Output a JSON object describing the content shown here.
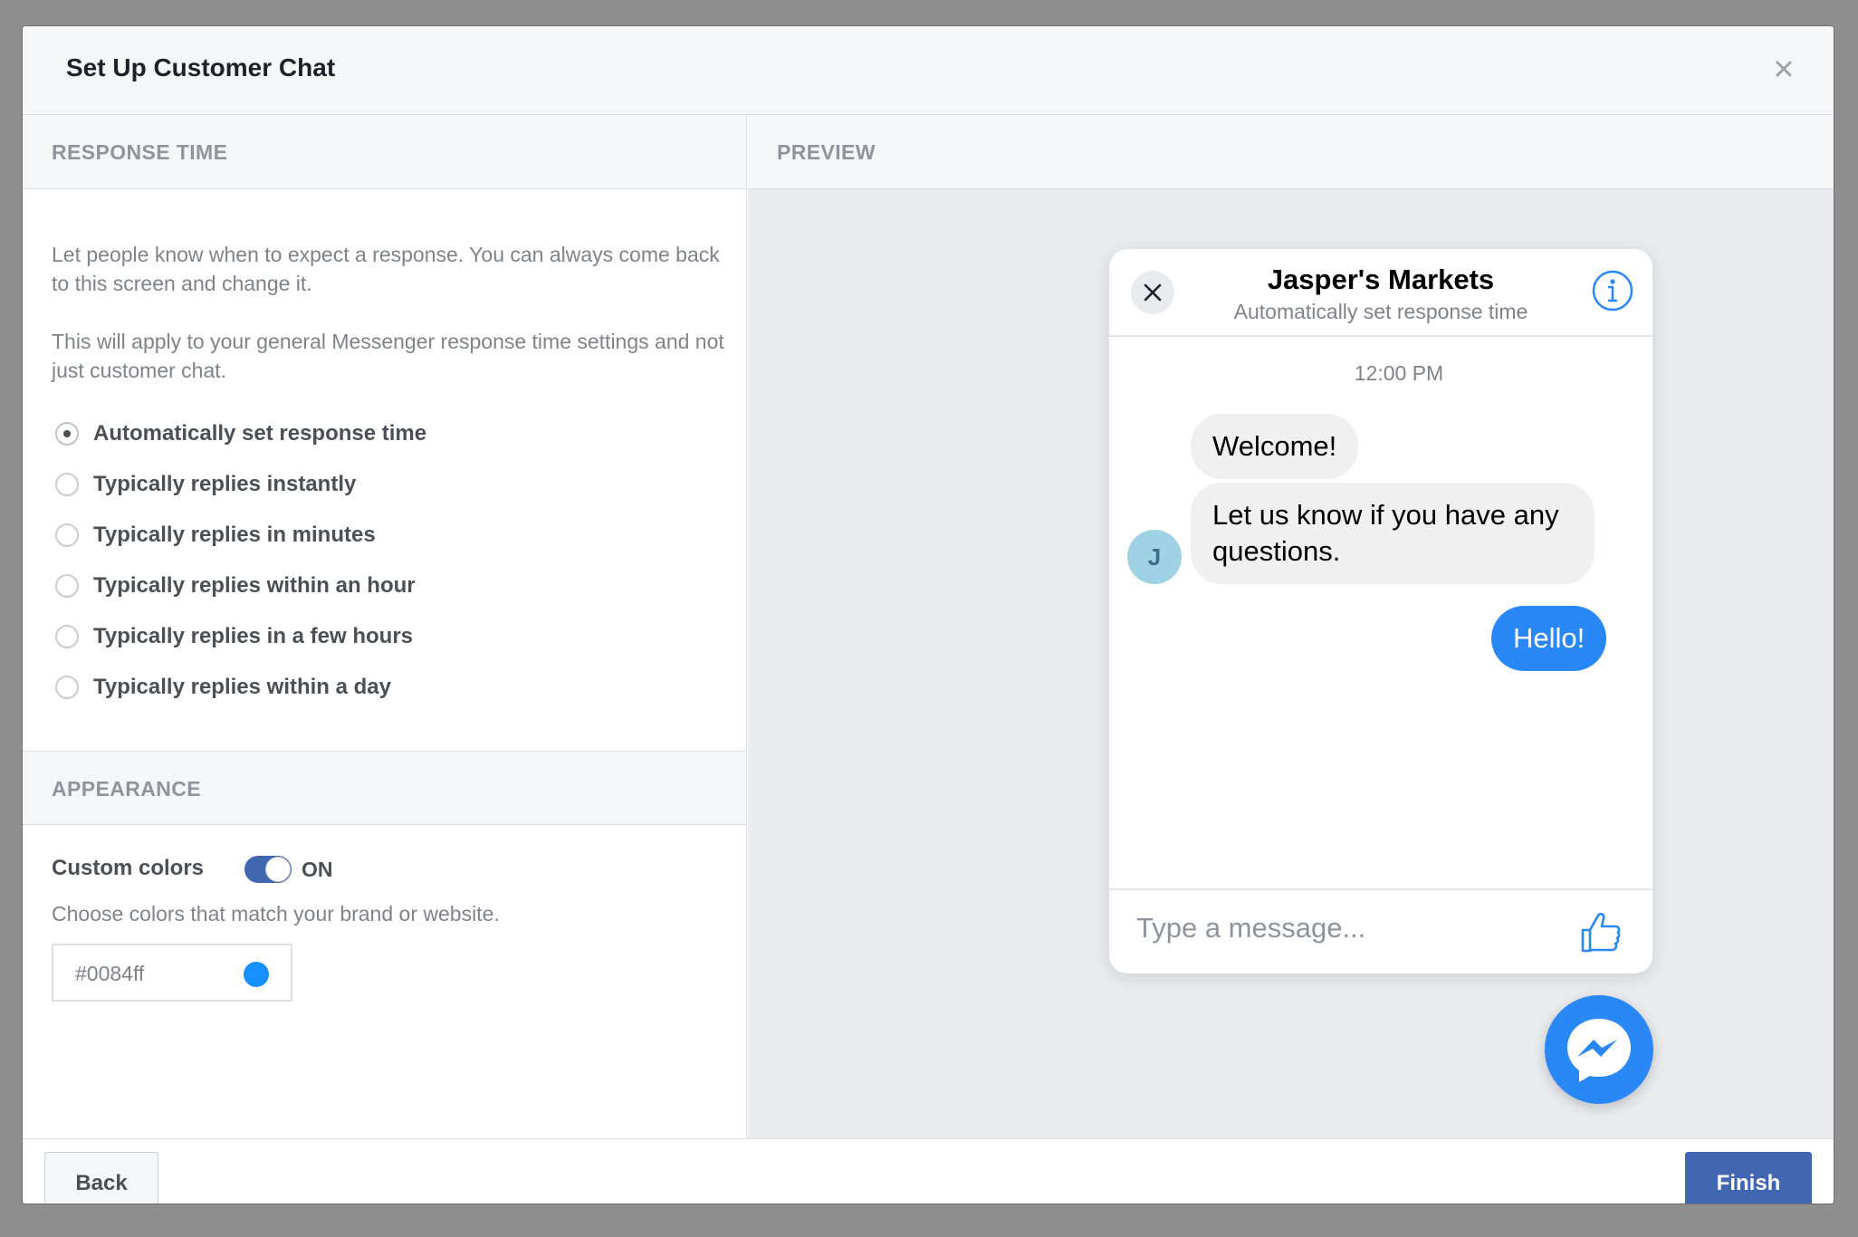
{
  "dialog": {
    "title": "Set Up Customer Chat"
  },
  "response_time": {
    "heading": "RESPONSE TIME",
    "description_1": "Let people know when to expect a response. You can always come back to this screen and change it.",
    "description_2": "This will apply to your general Messenger response time settings and not just customer chat.",
    "options": [
      {
        "label": "Automatically set response time",
        "selected": true
      },
      {
        "label": "Typically replies instantly",
        "selected": false
      },
      {
        "label": "Typically replies in minutes",
        "selected": false
      },
      {
        "label": "Typically replies within an hour",
        "selected": false
      },
      {
        "label": "Typically replies in a few hours",
        "selected": false
      },
      {
        "label": "Typically replies within a day",
        "selected": false
      }
    ]
  },
  "appearance": {
    "heading": "APPEARANCE",
    "custom_colors_label": "Custom colors",
    "toggle_state": "ON",
    "help_text": "Choose colors that match your brand or website.",
    "color_value": "#0084ff"
  },
  "preview": {
    "heading": "PREVIEW",
    "chat": {
      "page_name": "Jasper's Markets",
      "subtitle": "Automatically set response time",
      "timestamp": "12:00 PM",
      "avatar_initial": "J",
      "messages": [
        {
          "from": "page",
          "text": "Welcome!"
        },
        {
          "from": "page",
          "text": "Let us know if you have any questions."
        },
        {
          "from": "user",
          "text": "Hello!"
        }
      ],
      "composer_placeholder": "Type a message..."
    }
  },
  "footer": {
    "back_label": "Back",
    "finish_label": "Finish"
  },
  "colors": {
    "accent": "#4267b2",
    "messenger_blue": "#0084ff",
    "bubble_blue": "#2a87f6"
  }
}
